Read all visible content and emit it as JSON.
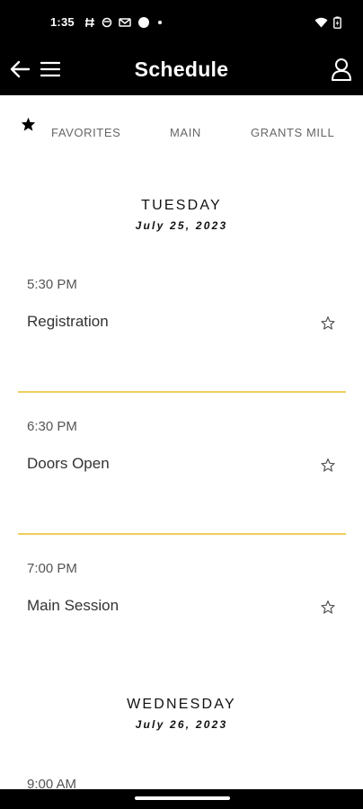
{
  "status_bar": {
    "time": "1:35",
    "left_icons": [
      "hashtag-icon",
      "circle-icon",
      "gmail-icon",
      "dot-icon",
      "small-dot-icon"
    ],
    "right_icons": [
      "wifi-icon",
      "battery-icon"
    ]
  },
  "app_bar": {
    "title": "Schedule",
    "back_icon": "arrow-left-icon",
    "menu_icon": "hamburger-menu-icon",
    "profile_icon": "user-icon"
  },
  "tabs": {
    "favorites_icon": "star-icon",
    "items": [
      {
        "label": "FAVORITES"
      },
      {
        "label": "MAIN"
      },
      {
        "label": "GRANTS MILL"
      }
    ]
  },
  "days": [
    {
      "name": "TUESDAY",
      "date": "July 25, 2023",
      "sessions": [
        {
          "time": "5:30 PM",
          "title": "Registration"
        },
        {
          "time": "6:30 PM",
          "title": "Doors Open"
        },
        {
          "time": "7:00 PM",
          "title": "Main Session"
        }
      ]
    },
    {
      "name": "WEDNESDAY",
      "date": "July 26, 2023",
      "sessions": [
        {
          "time": "9:00 AM",
          "title": ""
        }
      ]
    }
  ],
  "colors": {
    "header_bg": "#000000",
    "divider": "#f1cf5b",
    "text": "#333333"
  }
}
